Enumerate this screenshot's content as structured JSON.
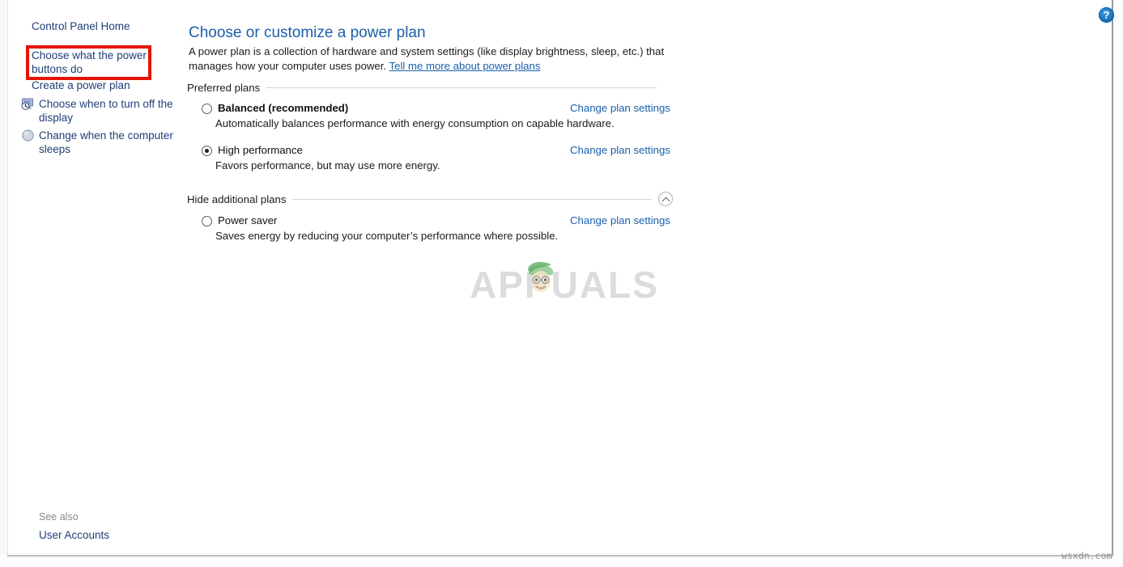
{
  "window": {
    "help_label": "?"
  },
  "sidebar": {
    "control_panel_home": "Control Panel Home",
    "items": [
      {
        "label": "Choose what the power\nbuttons do",
        "icon": null,
        "highlighted": true
      },
      {
        "label": "Create a power plan",
        "icon": null,
        "highlighted": false
      },
      {
        "label": "Choose when to turn off the\ndisplay",
        "icon": "display-clock-icon",
        "highlighted": false
      },
      {
        "label": "Change when the computer\nsleeps",
        "icon": "sleep-moon-icon",
        "highlighted": false
      }
    ],
    "see_also_label": "See also",
    "see_also_link": "User Accounts",
    "highlight_color": "#e51400"
  },
  "main": {
    "title": "Choose or customize a power plan",
    "description_part1": "A power plan is a collection of hardware and system settings (like display brightness, sleep, etc.) that manages how your computer uses power. ",
    "description_link": "Tell me more about power plans",
    "groups": [
      {
        "label": "Preferred plans",
        "has_collapse_button": false,
        "plans": [
          {
            "name": "Balanced (recommended)",
            "bold": true,
            "selected": false,
            "description": "Automatically balances performance with energy consumption on capable hardware.",
            "action": "Change plan settings"
          },
          {
            "name": "High performance",
            "bold": false,
            "selected": true,
            "description": "Favors performance, but may use more energy.",
            "action": "Change plan settings"
          }
        ]
      },
      {
        "label": "Hide additional plans",
        "has_collapse_button": true,
        "collapse_icon": "chevron-up-icon",
        "plans": [
          {
            "name": "Power saver",
            "bold": false,
            "selected": false,
            "description": "Saves energy by reducing your computer’s performance where possible.",
            "action": "Change plan settings"
          }
        ]
      }
    ]
  },
  "watermarks": {
    "center": "APPUALS",
    "corner": "wsxdn.com"
  },
  "colors": {
    "link": "#1b5faa",
    "sidebar_link": "#1f3f77",
    "title": "#1b5faa",
    "highlight": "#e51400"
  }
}
